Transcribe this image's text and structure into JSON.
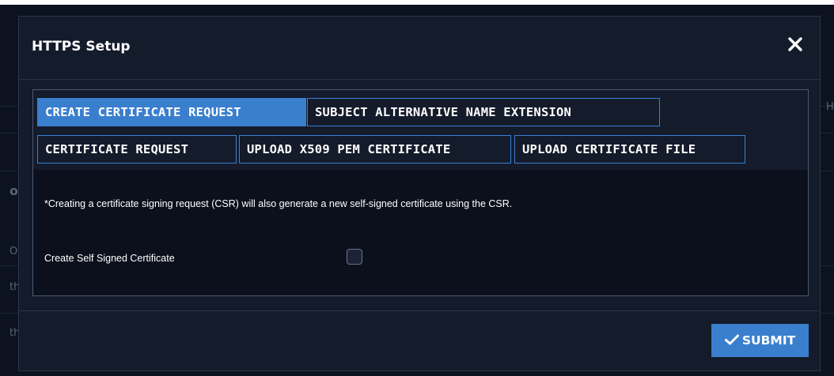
{
  "background": {
    "fragments": [
      "H",
      "o",
      "O",
      "th",
      "th"
    ]
  },
  "modal": {
    "title": "HTTPS Setup",
    "close_icon": "close-icon",
    "tabs": [
      {
        "label": "CREATE CERTIFICATE REQUEST",
        "active": true
      },
      {
        "label": "SUBJECT ALTERNATIVE NAME EXTENSION",
        "active": false
      },
      {
        "label": "CERTIFICATE REQUEST",
        "active": false
      },
      {
        "label": "UPLOAD X509 PEM CERTIFICATE",
        "active": false
      },
      {
        "label": "UPLOAD CERTIFICATE FILE",
        "active": false
      }
    ],
    "note": "*Creating a certificate signing request (CSR) will also generate a new self-signed certificate using the CSR.",
    "self_signed": {
      "label": "Create Self Signed Certificate",
      "checked": false
    },
    "submit": {
      "label": "SUBMIT",
      "icon": "check-icon"
    }
  },
  "colors": {
    "accent": "#3a7fce",
    "modal_bg": "#141b2b",
    "content_bg": "#0b101c"
  }
}
